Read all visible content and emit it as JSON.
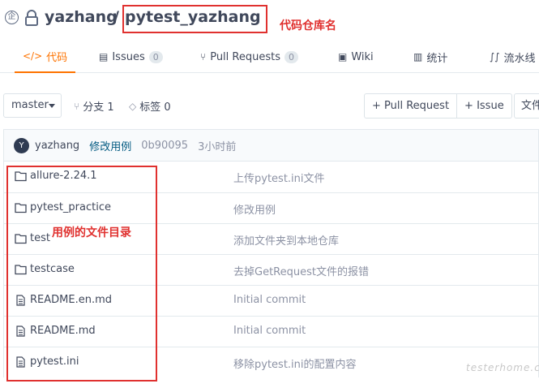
{
  "header": {
    "owner": "yazhang",
    "separator": "/",
    "repo_name": "pytest_yazhang"
  },
  "annotations": {
    "repo_name_label": "代码仓库名",
    "files_label": "用例的文件目录"
  },
  "tabs": [
    {
      "label": "代码",
      "icon": "code-icon",
      "active": true
    },
    {
      "label": "Issues",
      "count": "0",
      "icon": "issues-icon"
    },
    {
      "label": "Pull Requests",
      "count": "0",
      "icon": "pull-request-icon"
    },
    {
      "label": "Wiki",
      "icon": "wiki-icon"
    },
    {
      "label": "统计",
      "icon": "stats-icon"
    },
    {
      "label": "流水线",
      "icon": "pipeline-icon"
    }
  ],
  "toolbar": {
    "branch": "master",
    "branches_label": "分支 1",
    "tags_label": "标签 0",
    "pull_request_btn": "+ Pull Request",
    "issue_btn": "+ Issue",
    "file_btn": "文件"
  },
  "commit": {
    "avatar_letter": "Y",
    "author": "yazhang",
    "message": "修改用例",
    "sha": "0b90095",
    "time": "3小时前"
  },
  "files": [
    {
      "name": "allure-2.24.1",
      "type": "folder",
      "commit": "上传pytest.ini文件"
    },
    {
      "name": "pytest_practice",
      "type": "folder",
      "commit": "修改用例"
    },
    {
      "name": "test",
      "type": "folder",
      "commit": "添加文件夹到本地仓库"
    },
    {
      "name": "testcase",
      "type": "folder",
      "commit": "去掉GetRequest文件的报错"
    },
    {
      "name": "README.en.md",
      "type": "file",
      "commit": "Initial commit"
    },
    {
      "name": "README.md",
      "type": "file",
      "commit": "Initial commit"
    },
    {
      "name": "pytest.ini",
      "type": "file",
      "commit": "移除pytest.ini的配置内容"
    }
  ],
  "watermark": "testerhome.com",
  "colors": {
    "accent": "#fe7300",
    "annotation": "#e0312f",
    "link": "#005980"
  }
}
